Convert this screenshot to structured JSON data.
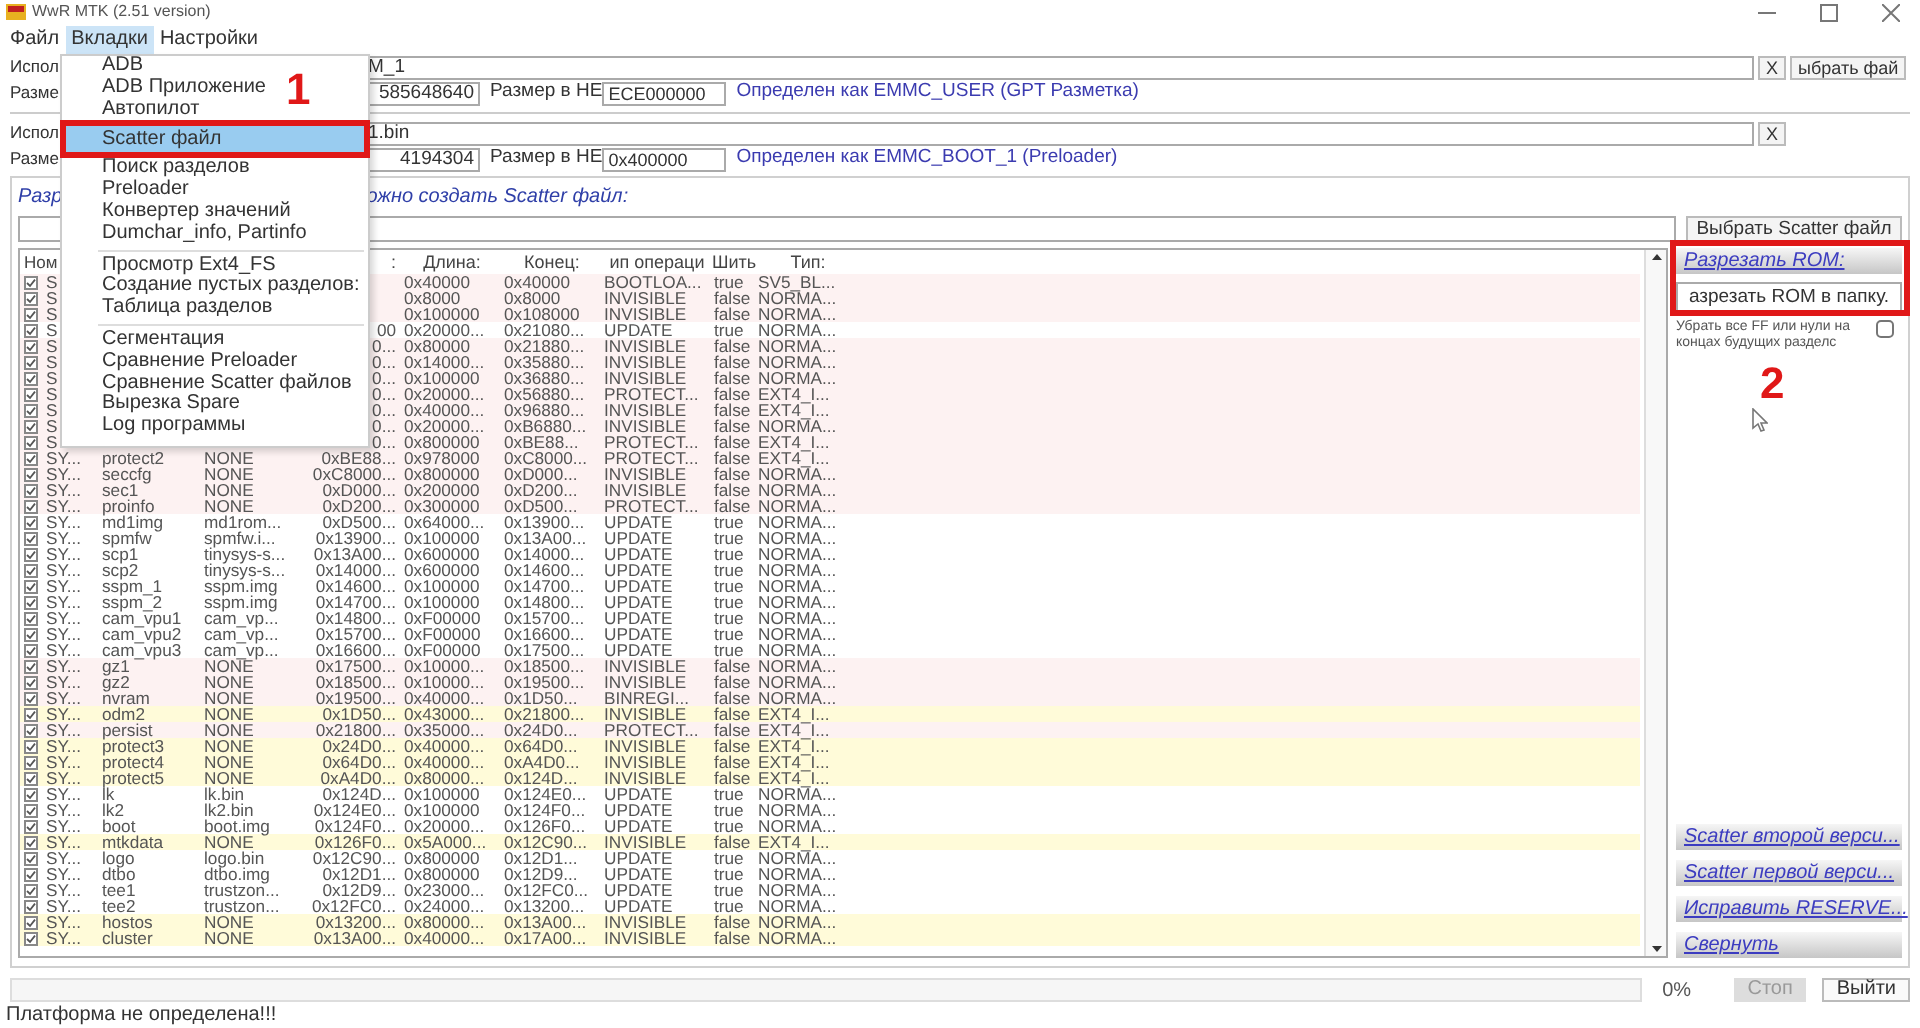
{
  "window": {
    "title": "WwR MTK (2.51 version)"
  },
  "menu_bar": [
    {
      "label": "Файл",
      "selected": false
    },
    {
      "label": "Вкладки",
      "selected": true
    },
    {
      "label": "Настройки",
      "selected": false
    }
  ],
  "menu": [
    {
      "kind": "item",
      "label": "ADB",
      "selected": false
    },
    {
      "kind": "item",
      "label": "ADB Приложение",
      "selected": false
    },
    {
      "kind": "item",
      "label": "Автопилот",
      "selected": false
    },
    {
      "kind": "item",
      "label": "Scatter файл",
      "selected": true
    },
    {
      "kind": "item",
      "label": "Поиск разделов",
      "selected": false
    },
    {
      "kind": "item",
      "label": "Preloader",
      "selected": false
    },
    {
      "kind": "item",
      "label": "Конвертер значений",
      "selected": false
    },
    {
      "kind": "item",
      "label": "Dumchar_info, Partinfo",
      "selected": false
    },
    {
      "kind": "separator"
    },
    {
      "kind": "item",
      "label": "Просмотр Ext4_FS",
      "selected": false
    },
    {
      "kind": "item",
      "label": "Создание пустых разделов:",
      "selected": false
    },
    {
      "kind": "item",
      "label": "Таблица разделов",
      "selected": false
    },
    {
      "kind": "separator"
    },
    {
      "kind": "item",
      "label": "Сегментация",
      "selected": false
    },
    {
      "kind": "item",
      "label": "Сравнение Preloader",
      "selected": false
    },
    {
      "kind": "item",
      "label": "Сравнение Scatter файлов",
      "selected": false
    },
    {
      "kind": "item",
      "label": "Вырезка Spare",
      "selected": false
    },
    {
      "kind": "item",
      "label": "Log программы",
      "selected": false
    }
  ],
  "sources": [
    {
      "label": "Испол",
      "path": "M_1",
      "clear_button": "X",
      "browse_button": "ыбрать фай",
      "size_label": "Разме",
      "size": "585648640",
      "hex_label": "Размер в НЕ",
      "hex": "ECE000000",
      "detected": "Определен как EMMC_USER (GPT Разметка)"
    },
    {
      "label": "Испол",
      "path": "1.bin",
      "clear_button": "X",
      "size_label": "Разме",
      "size": "4194304",
      "hex_label": "Размер в НЕ",
      "hex": "0x400000",
      "detected": "Определен как EMMC_BOOT_1 (Preloader)"
    }
  ],
  "scatter": {
    "heading_start": "Разр",
    "heading_end": "ожно создать Scatter файл:",
    "browse_button": "Выбрать Scatter файл"
  },
  "table": {
    "columns": [
      "Ном",
      null,
      null,
      ":",
      "Длина:",
      "Конец:",
      "ип операци",
      "Шить",
      "Тип:"
    ],
    "rows": [
      {
        "checked": true,
        "color": "#fdf2f2",
        "number": "S",
        "length": "0x40000",
        "end": "0x40000",
        "operation": "BOOTLOA...",
        "write": "true",
        "type": "SV5_BL..."
      },
      {
        "checked": true,
        "color": "#fdf2f2",
        "number": "S",
        "length": "0x8000",
        "end": "0x8000",
        "operation": "INVISIBLE",
        "write": "false",
        "type": "NORMA..."
      },
      {
        "checked": true,
        "color": "#fdf2f2",
        "number": "S",
        "length": "0x100000",
        "end": "0x108000",
        "operation": "INVISIBLE",
        "write": "false",
        "type": "NORMA..."
      },
      {
        "checked": true,
        "color": "#ffffff",
        "number": "S",
        "start": "00",
        "length": "0x20000...",
        "end": "0x21080...",
        "operation": "UPDATE",
        "write": "true",
        "type": "NORMA..."
      },
      {
        "checked": true,
        "color": "#fdf2f2",
        "number": "S",
        "start": "0...",
        "length": "0x80000",
        "end": "0x21880...",
        "operation": "INVISIBLE",
        "write": "false",
        "type": "NORMA..."
      },
      {
        "checked": true,
        "color": "#fdf2f2",
        "number": "S",
        "start": "0...",
        "length": "0x14000...",
        "end": "0x35880...",
        "operation": "INVISIBLE",
        "write": "false",
        "type": "NORMA..."
      },
      {
        "checked": true,
        "color": "#fdf2f2",
        "number": "S",
        "start": "0...",
        "length": "0x100000",
        "end": "0x36880...",
        "operation": "INVISIBLE",
        "write": "false",
        "type": "NORMA..."
      },
      {
        "checked": true,
        "color": "#fdf2f2",
        "number": "S",
        "start": "0...",
        "length": "0x20000...",
        "end": "0x56880...",
        "operation": "PROTECT...",
        "write": "false",
        "type": "EXT4_I..."
      },
      {
        "checked": true,
        "color": "#fdf2f2",
        "number": "S",
        "start": "0...",
        "length": "0x40000...",
        "end": "0x96880...",
        "operation": "INVISIBLE",
        "write": "false",
        "type": "EXT4_I..."
      },
      {
        "checked": true,
        "color": "#fdf2f2",
        "number": "S",
        "start": "0...",
        "length": "0x20000...",
        "end": "0xB6880...",
        "operation": "INVISIBLE",
        "write": "false",
        "type": "NORMA..."
      },
      {
        "checked": true,
        "color": "#fdf2f2",
        "number": "S",
        "start": "0...",
        "length": "0x800000",
        "end": "0xBE88...",
        "operation": "PROTECT...",
        "write": "false",
        "type": "EXT4_I..."
      },
      {
        "checked": true,
        "color": "#fdf2f2",
        "number": "SY...",
        "name": "protect2",
        "file": "NONE",
        "start": "0xBE88...",
        "length": "0x978000",
        "end": "0xC8000...",
        "operation": "PROTECT...",
        "write": "false",
        "type": "EXT4_I..."
      },
      {
        "checked": true,
        "color": "#fdf2f2",
        "number": "SY...",
        "name": "seccfg",
        "file": "NONE",
        "start": "0xC8000...",
        "length": "0x800000",
        "end": "0xD000...",
        "operation": "INVISIBLE",
        "write": "false",
        "type": "NORMA..."
      },
      {
        "checked": true,
        "color": "#fdf2f2",
        "number": "SY...",
        "name": "sec1",
        "file": "NONE",
        "start": "0xD000...",
        "length": "0x200000",
        "end": "0xD200...",
        "operation": "INVISIBLE",
        "write": "false",
        "type": "NORMA..."
      },
      {
        "checked": true,
        "color": "#fdf2f2",
        "number": "SY...",
        "name": "proinfo",
        "file": "NONE",
        "start": "0xD200...",
        "length": "0x300000",
        "end": "0xD500...",
        "operation": "PROTECT...",
        "write": "false",
        "type": "NORMA..."
      },
      {
        "checked": true,
        "color": "#ffffff",
        "number": "SY...",
        "name": "md1img",
        "file": "md1rom...",
        "start": "0xD500...",
        "length": "0x64000...",
        "end": "0x13900...",
        "operation": "UPDATE",
        "write": "true",
        "type": "NORMA..."
      },
      {
        "checked": true,
        "color": "#ffffff",
        "number": "SY...",
        "name": "spmfw",
        "file": "spmfw.i...",
        "start": "0x13900...",
        "length": "0x100000",
        "end": "0x13A00...",
        "operation": "UPDATE",
        "write": "true",
        "type": "NORMA..."
      },
      {
        "checked": true,
        "color": "#ffffff",
        "number": "SY...",
        "name": "scp1",
        "file": "tinysys-s...",
        "start": "0x13A00...",
        "length": "0x600000",
        "end": "0x14000...",
        "operation": "UPDATE",
        "write": "true",
        "type": "NORMA..."
      },
      {
        "checked": true,
        "color": "#ffffff",
        "number": "SY...",
        "name": "scp2",
        "file": "tinysys-s...",
        "start": "0x14000...",
        "length": "0x600000",
        "end": "0x14600...",
        "operation": "UPDATE",
        "write": "true",
        "type": "NORMA..."
      },
      {
        "checked": true,
        "color": "#ffffff",
        "number": "SY...",
        "name": "sspm_1",
        "file": "sspm.img",
        "start": "0x14600...",
        "length": "0x100000",
        "end": "0x14700...",
        "operation": "UPDATE",
        "write": "true",
        "type": "NORMA..."
      },
      {
        "checked": true,
        "color": "#ffffff",
        "number": "SY...",
        "name": "sspm_2",
        "file": "sspm.img",
        "start": "0x14700...",
        "length": "0x100000",
        "end": "0x14800...",
        "operation": "UPDATE",
        "write": "true",
        "type": "NORMA..."
      },
      {
        "checked": true,
        "color": "#ffffff",
        "number": "SY...",
        "name": "cam_vpu1",
        "file": "cam_vp...",
        "start": "0x14800...",
        "length": "0xF00000",
        "end": "0x15700...",
        "operation": "UPDATE",
        "write": "true",
        "type": "NORMA..."
      },
      {
        "checked": true,
        "color": "#ffffff",
        "number": "SY...",
        "name": "cam_vpu2",
        "file": "cam_vp...",
        "start": "0x15700...",
        "length": "0xF00000",
        "end": "0x16600...",
        "operation": "UPDATE",
        "write": "true",
        "type": "NORMA..."
      },
      {
        "checked": true,
        "color": "#ffffff",
        "number": "SY...",
        "name": "cam_vpu3",
        "file": "cam_vp...",
        "start": "0x16600...",
        "length": "0xF00000",
        "end": "0x17500...",
        "operation": "UPDATE",
        "write": "true",
        "type": "NORMA..."
      },
      {
        "checked": true,
        "color": "#fdf2f2",
        "number": "SY...",
        "name": "gz1",
        "file": "NONE",
        "start": "0x17500...",
        "length": "0x10000...",
        "end": "0x18500...",
        "operation": "INVISIBLE",
        "write": "false",
        "type": "NORMA..."
      },
      {
        "checked": true,
        "color": "#fdf2f2",
        "number": "SY...",
        "name": "gz2",
        "file": "NONE",
        "start": "0x18500...",
        "length": "0x10000...",
        "end": "0x19500...",
        "operation": "INVISIBLE",
        "write": "false",
        "type": "NORMA..."
      },
      {
        "checked": true,
        "color": "#fdf2f2",
        "number": "SY...",
        "name": "nvram",
        "file": "NONE",
        "start": "0x19500...",
        "length": "0x40000...",
        "end": "0x1D50...",
        "operation": "BINREGI...",
        "write": "false",
        "type": "NORMA..."
      },
      {
        "checked": true,
        "color": "#fffbd9",
        "number": "SY...",
        "name": "odm2",
        "file": "NONE",
        "start": "0x1D50...",
        "length": "0x43000...",
        "end": "0x21800...",
        "operation": "INVISIBLE",
        "write": "false",
        "type": "EXT4_I..."
      },
      {
        "checked": true,
        "color": "#fdf2f2",
        "number": "SY...",
        "name": "persist",
        "file": "NONE",
        "start": "0x21800...",
        "length": "0x35000...",
        "end": "0x24D0...",
        "operation": "PROTECT...",
        "write": "false",
        "type": "EXT4_I..."
      },
      {
        "checked": true,
        "color": "#fffbd9",
        "number": "SY...",
        "name": "protect3",
        "file": "NONE",
        "start": "0x24D0...",
        "length": "0x40000...",
        "end": "0x64D0...",
        "operation": "INVISIBLE",
        "write": "false",
        "type": "EXT4_I..."
      },
      {
        "checked": true,
        "color": "#fffbd9",
        "number": "SY...",
        "name": "protect4",
        "file": "NONE",
        "start": "0x64D0...",
        "length": "0x40000...",
        "end": "0xA4D0...",
        "operation": "INVISIBLE",
        "write": "false",
        "type": "EXT4_I..."
      },
      {
        "checked": true,
        "color": "#fffbd9",
        "number": "SY...",
        "name": "protect5",
        "file": "NONE",
        "start": "0xA4D0...",
        "length": "0x80000...",
        "end": "0x124D...",
        "operation": "INVISIBLE",
        "write": "false",
        "type": "EXT4_I..."
      },
      {
        "checked": true,
        "color": "#ffffff",
        "number": "SY...",
        "name": "lk",
        "file": "lk.bin",
        "start": "0x124D...",
        "length": "0x100000",
        "end": "0x124E0...",
        "operation": "UPDATE",
        "write": "true",
        "type": "NORMA..."
      },
      {
        "checked": true,
        "color": "#ffffff",
        "number": "SY...",
        "name": "lk2",
        "file": "lk2.bin",
        "start": "0x124E0...",
        "length": "0x100000",
        "end": "0x124F0...",
        "operation": "UPDATE",
        "write": "true",
        "type": "NORMA..."
      },
      {
        "checked": true,
        "color": "#ffffff",
        "number": "SY...",
        "name": "boot",
        "file": "boot.img",
        "start": "0x124F0...",
        "length": "0x20000...",
        "end": "0x126F0...",
        "operation": "UPDATE",
        "write": "true",
        "type": "NORMA..."
      },
      {
        "checked": true,
        "color": "#fffbd9",
        "number": "SY...",
        "name": "mtkdata",
        "file": "NONE",
        "start": "0x126F0...",
        "length": "0x5A000...",
        "end": "0x12C90...",
        "operation": "INVISIBLE",
        "write": "false",
        "type": "EXT4_I..."
      },
      {
        "checked": true,
        "color": "#ffffff",
        "number": "SY...",
        "name": "logo",
        "file": "logo.bin",
        "start": "0x12C90...",
        "length": "0x800000",
        "end": "0x12D1...",
        "operation": "UPDATE",
        "write": "true",
        "type": "NORMA..."
      },
      {
        "checked": true,
        "color": "#ffffff",
        "number": "SY...",
        "name": "dtbo",
        "file": "dtbo.img",
        "start": "0x12D1...",
        "length": "0x800000",
        "end": "0x12D9...",
        "operation": "UPDATE",
        "write": "true",
        "type": "NORMA..."
      },
      {
        "checked": true,
        "color": "#ffffff",
        "number": "SY...",
        "name": "tee1",
        "file": "trustzon...",
        "start": "0x12D9...",
        "length": "0x23000...",
        "end": "0x12FC0...",
        "operation": "UPDATE",
        "write": "true",
        "type": "NORMA..."
      },
      {
        "checked": true,
        "color": "#ffffff",
        "number": "SY...",
        "name": "tee2",
        "file": "trustzon...",
        "start": "0x12FC0...",
        "length": "0x24000...",
        "end": "0x13200...",
        "operation": "UPDATE",
        "write": "true",
        "type": "NORMA..."
      },
      {
        "checked": true,
        "color": "#fffbd9",
        "number": "SY...",
        "name": "hostos",
        "file": "NONE",
        "start": "0x13200...",
        "length": "0x80000...",
        "end": "0x13A00...",
        "operation": "INVISIBLE",
        "write": "false",
        "type": "NORMA..."
      },
      {
        "checked": true,
        "color": "#fffbd9",
        "number": "SY...",
        "name": "cluster",
        "file": "NONE",
        "start": "0x13A00...",
        "length": "0x40000...",
        "end": "0x17A00...",
        "operation": "INVISIBLE",
        "write": "false",
        "type": "NORMA..."
      }
    ]
  },
  "panel": {
    "cut_heading": "Разрезать ROM:",
    "cut_button": "азрезать ROM в папку.",
    "trim_option": {
      "label": "Убрать все FF или нули на концах будущих разделс",
      "checked": false
    },
    "actions": [
      "Scatter второй верси...",
      "Scatter первой верси...",
      "Исправить RESERVE...",
      "Свернуть"
    ]
  },
  "progress": {
    "level": 0,
    "reading": "0%"
  },
  "buttons": [
    {
      "label": "Стоп",
      "disabled": true
    },
    {
      "label": "Выйти",
      "disabled": false
    }
  ],
  "status_bar": "Платформа не определена!!!",
  "annotations": [
    {
      "text": "1"
    },
    {
      "text": "2"
    }
  ]
}
